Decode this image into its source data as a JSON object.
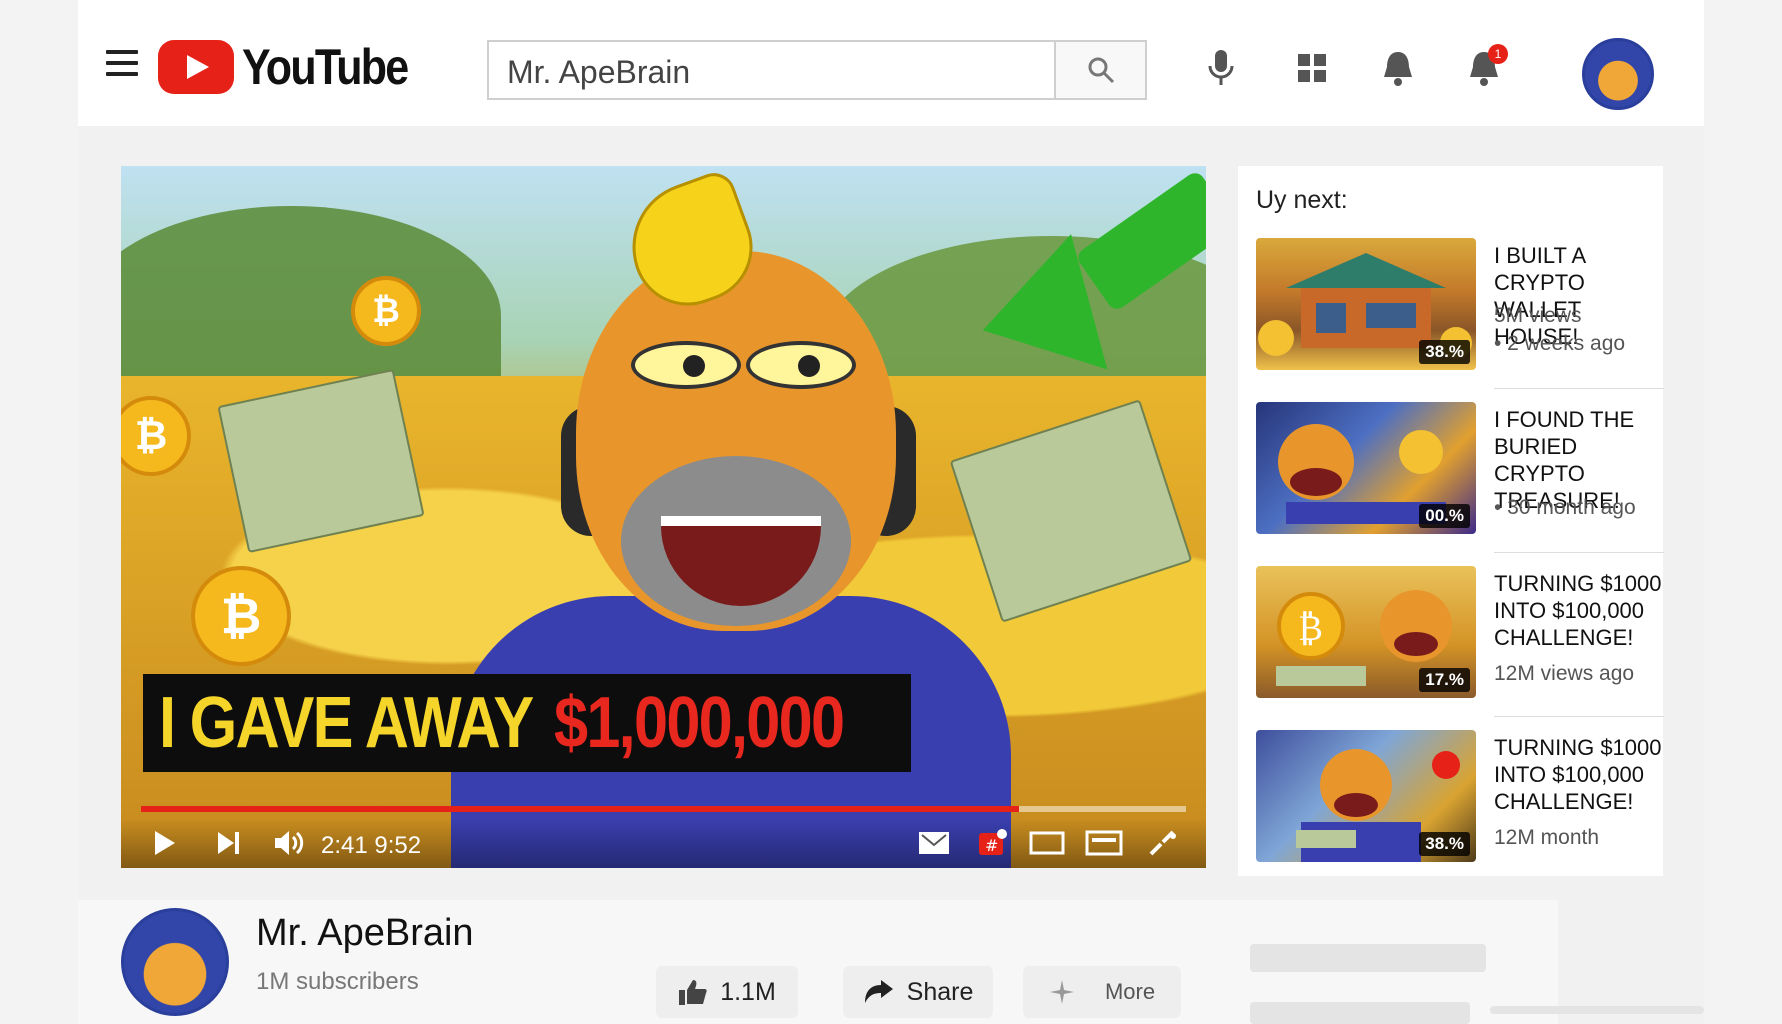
{
  "header": {
    "logo_text": "YouTube",
    "search_value": "Mr. ApeBrain",
    "notification_count": "1"
  },
  "video": {
    "banner_text_white": "I GAVE AWAY",
    "banner_text_red": "$1,000,000",
    "time_current": "2:41",
    "time_total": "9:52",
    "progress_fraction": 0.84
  },
  "sidebar": {
    "heading": "Uy next:",
    "items": [
      {
        "title": "I BUILT A CRYPTO WALLET HOUSE!",
        "meta1": "5M views",
        "meta2": "• 2 weeks ago",
        "badge": "38.%"
      },
      {
        "title": "I FOUND THE BURIED CRYPTO TREASURE!",
        "meta1": "",
        "meta2": "• 30 month ago",
        "badge": "00.%"
      },
      {
        "title": "TURNING $1000 INTO $100,000 CHALLENGE!",
        "meta1": "12M views ago",
        "meta2": "",
        "badge": "17.%"
      },
      {
        "title": "TURNING $1000 INTO $100,000 CHALLENGE!",
        "meta1": "12M month",
        "meta2": "",
        "badge": "38.%"
      }
    ]
  },
  "channel": {
    "name": "Mr. ApeBrain",
    "subscribers": "1M subscribers",
    "likes": "1.1M",
    "share_label": "Share",
    "more_label": "More"
  },
  "colors": {
    "brand_red": "#e62117",
    "banner_yellow": "#f5d52a",
    "hoodie_blue": "#3a3fb0"
  }
}
